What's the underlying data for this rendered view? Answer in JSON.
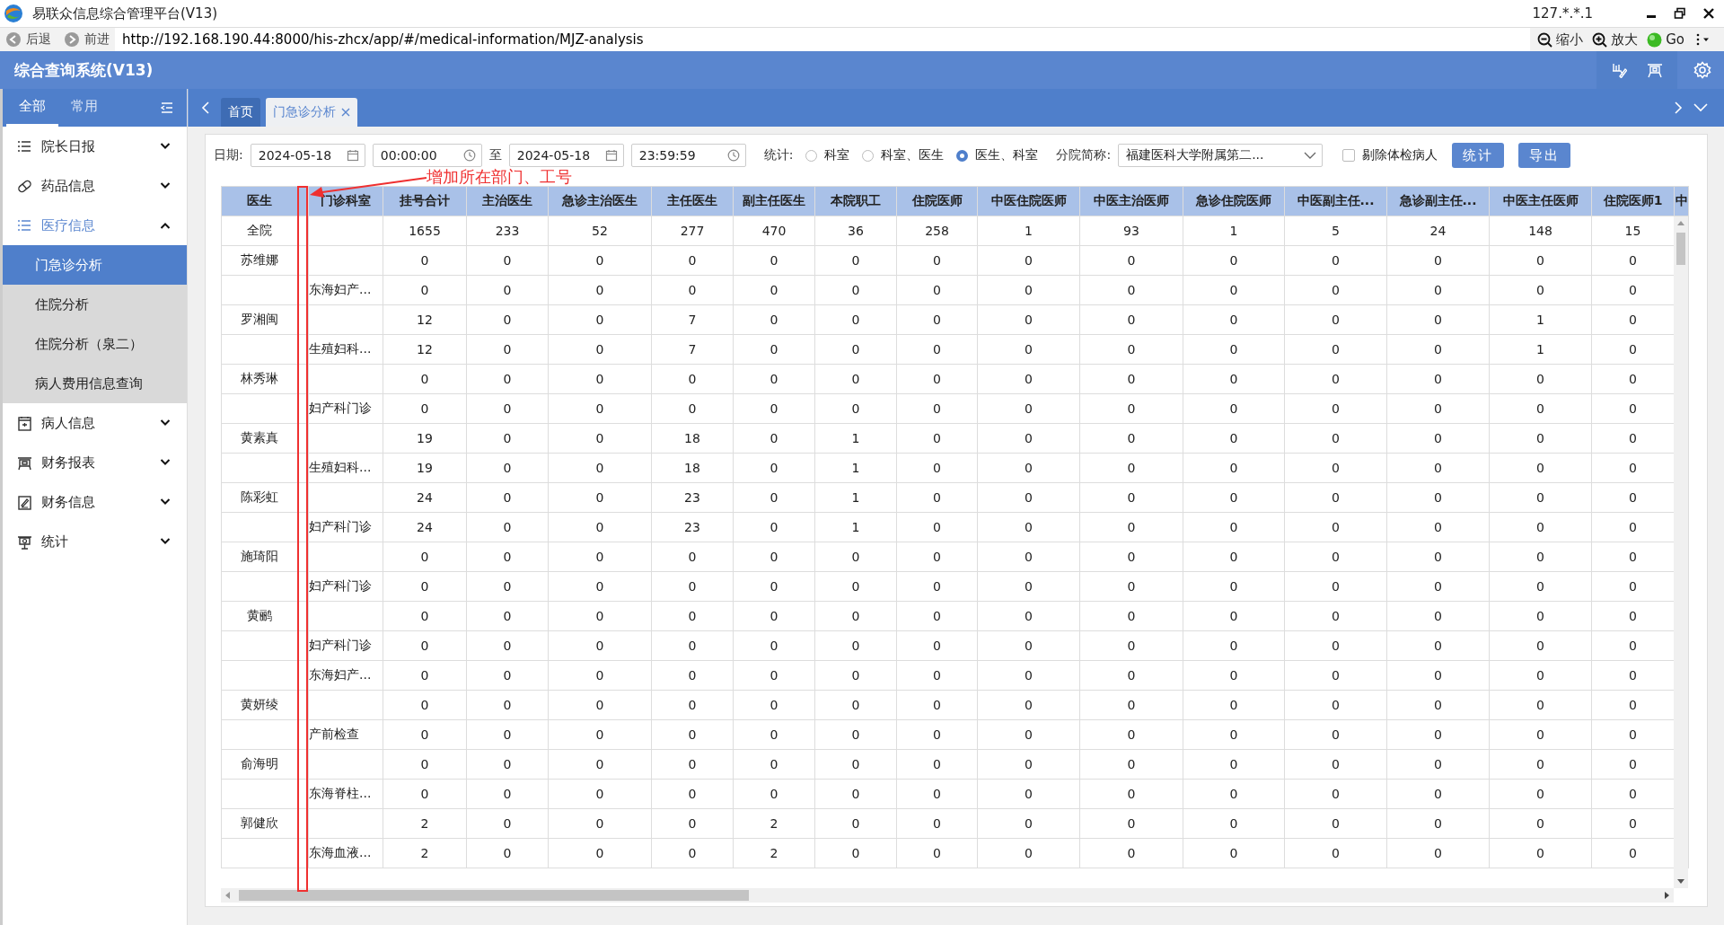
{
  "browser": {
    "title": "易联众信息综合管理平台(V13)",
    "host": "127.*.*.1",
    "nav": [
      {
        "label": "后退",
        "kind": "back"
      },
      {
        "label": "前进",
        "kind": "forward"
      }
    ],
    "url": "http://192.168.190.44:8000/his-zhcx/app/#/medical-information/MJZ-analysis",
    "tools": [
      {
        "label": "缩小",
        "kind": "zoom-out"
      },
      {
        "label": "放大",
        "kind": "zoom-in"
      },
      {
        "label": "Go",
        "kind": "go"
      }
    ]
  },
  "app": {
    "title": "综合查询系统(V13)"
  },
  "sidebar": {
    "tabs": [
      {
        "label": "全部",
        "selected": true
      },
      {
        "label": "常用",
        "selected": false
      }
    ],
    "items": [
      {
        "label": "院长日报",
        "kind": "list",
        "expanded": false
      },
      {
        "label": "药品信息",
        "kind": "pill",
        "expanded": false
      },
      {
        "label": "医疗信息",
        "kind": "list",
        "expanded": true,
        "children": [
          {
            "label": "门急诊分析",
            "selected": true
          },
          {
            "label": "住院分析",
            "selected": false
          },
          {
            "label": "住院分析（泉二）",
            "selected": false
          },
          {
            "label": "病人费用信息查询",
            "selected": false
          }
        ]
      },
      {
        "label": "病人信息",
        "kind": "calendar",
        "expanded": false
      },
      {
        "label": "财务报表",
        "kind": "board",
        "expanded": false
      },
      {
        "label": "财务信息",
        "kind": "edit",
        "expanded": false
      },
      {
        "label": "统计",
        "kind": "easel",
        "expanded": false
      }
    ]
  },
  "tabs": [
    {
      "label": "首页",
      "selected": false,
      "closable": false
    },
    {
      "label": "门急诊分析",
      "selected": true,
      "closable": true
    }
  ],
  "filter": {
    "date_label": "日期:",
    "start_date": "2024-05-18",
    "start_time": "00:00:00",
    "to_label": "至",
    "end_date": "2024-05-18",
    "end_time": "23:59:59",
    "stat_label": "统计:",
    "stat_options": [
      {
        "label": "科室",
        "selected": false
      },
      {
        "label": "科室、医生",
        "selected": false
      },
      {
        "label": "医生、科室",
        "selected": true
      }
    ],
    "branch_label": "分院简称:",
    "branch": "福建医科大学附属第二...",
    "exclude": {
      "label": "剔除体检病人",
      "checked": false
    },
    "buttons": [
      "统计",
      "导出"
    ]
  },
  "table": {
    "columns": [
      "医生",
      "门诊科室",
      "挂号合计",
      "主治医生",
      "急诊主治医生",
      "主任医生",
      "副主任医生",
      "本院职工",
      "住院医师",
      "中医住院医师",
      "中医主治医师",
      "急诊住院医师",
      "中医副主任...",
      "急诊副主任...",
      "中医主任医师",
      "住院医师1",
      "中"
    ],
    "rows": [
      {
        "doctor": "全院",
        "values": [
          "1655",
          "233",
          "52",
          "277",
          "470",
          "36",
          "258",
          "1",
          "93",
          "1",
          "5",
          "24",
          "148",
          "15"
        ]
      },
      {
        "doctor": "苏维娜",
        "values": [
          "0",
          "0",
          "0",
          "0",
          "0",
          "0",
          "0",
          "0",
          "0",
          "0",
          "0",
          "0",
          "0",
          "0"
        ]
      },
      {
        "dept": "东海妇产...",
        "values": [
          "0",
          "0",
          "0",
          "0",
          "0",
          "0",
          "0",
          "0",
          "0",
          "0",
          "0",
          "0",
          "0",
          "0"
        ]
      },
      {
        "doctor": "罗湘闽",
        "values": [
          "12",
          "0",
          "0",
          "7",
          "0",
          "0",
          "0",
          "0",
          "0",
          "0",
          "0",
          "0",
          "1",
          "0"
        ]
      },
      {
        "dept": "生殖妇科...",
        "values": [
          "12",
          "0",
          "0",
          "7",
          "0",
          "0",
          "0",
          "0",
          "0",
          "0",
          "0",
          "0",
          "1",
          "0"
        ]
      },
      {
        "doctor": "林秀琳",
        "values": [
          "0",
          "0",
          "0",
          "0",
          "0",
          "0",
          "0",
          "0",
          "0",
          "0",
          "0",
          "0",
          "0",
          "0"
        ]
      },
      {
        "dept": "妇产科门诊",
        "values": [
          "0",
          "0",
          "0",
          "0",
          "0",
          "0",
          "0",
          "0",
          "0",
          "0",
          "0",
          "0",
          "0",
          "0"
        ]
      },
      {
        "doctor": "黄素真",
        "values": [
          "19",
          "0",
          "0",
          "18",
          "0",
          "1",
          "0",
          "0",
          "0",
          "0",
          "0",
          "0",
          "0",
          "0"
        ]
      },
      {
        "dept": "生殖妇科...",
        "values": [
          "19",
          "0",
          "0",
          "18",
          "0",
          "1",
          "0",
          "0",
          "0",
          "0",
          "0",
          "0",
          "0",
          "0"
        ]
      },
      {
        "doctor": "陈彩虹",
        "values": [
          "24",
          "0",
          "0",
          "23",
          "0",
          "1",
          "0",
          "0",
          "0",
          "0",
          "0",
          "0",
          "0",
          "0"
        ]
      },
      {
        "dept": "妇产科门诊",
        "values": [
          "24",
          "0",
          "0",
          "23",
          "0",
          "1",
          "0",
          "0",
          "0",
          "0",
          "0",
          "0",
          "0",
          "0"
        ]
      },
      {
        "doctor": "施琦阳",
        "values": [
          "0",
          "0",
          "0",
          "0",
          "0",
          "0",
          "0",
          "0",
          "0",
          "0",
          "0",
          "0",
          "0",
          "0"
        ]
      },
      {
        "dept": "妇产科门诊",
        "values": [
          "0",
          "0",
          "0",
          "0",
          "0",
          "0",
          "0",
          "0",
          "0",
          "0",
          "0",
          "0",
          "0",
          "0"
        ]
      },
      {
        "doctor": "黄鹂",
        "values": [
          "0",
          "0",
          "0",
          "0",
          "0",
          "0",
          "0",
          "0",
          "0",
          "0",
          "0",
          "0",
          "0",
          "0"
        ]
      },
      {
        "dept": "妇产科门诊",
        "values": [
          "0",
          "0",
          "0",
          "0",
          "0",
          "0",
          "0",
          "0",
          "0",
          "0",
          "0",
          "0",
          "0",
          "0"
        ]
      },
      {
        "dept": "东海妇产...",
        "values": [
          "0",
          "0",
          "0",
          "0",
          "0",
          "0",
          "0",
          "0",
          "0",
          "0",
          "0",
          "0",
          "0",
          "0"
        ]
      },
      {
        "doctor": "黄妍绫",
        "values": [
          "0",
          "0",
          "0",
          "0",
          "0",
          "0",
          "0",
          "0",
          "0",
          "0",
          "0",
          "0",
          "0",
          "0"
        ]
      },
      {
        "dept": "产前检查",
        "values": [
          "0",
          "0",
          "0",
          "0",
          "0",
          "0",
          "0",
          "0",
          "0",
          "0",
          "0",
          "0",
          "0",
          "0"
        ]
      },
      {
        "doctor": "俞海明",
        "values": [
          "0",
          "0",
          "0",
          "0",
          "0",
          "0",
          "0",
          "0",
          "0",
          "0",
          "0",
          "0",
          "0",
          "0"
        ]
      },
      {
        "dept": "东海脊柱...",
        "values": [
          "0",
          "0",
          "0",
          "0",
          "0",
          "0",
          "0",
          "0",
          "0",
          "0",
          "0",
          "0",
          "0",
          "0"
        ]
      },
      {
        "doctor": "郭健欣",
        "values": [
          "2",
          "0",
          "0",
          "0",
          "2",
          "0",
          "0",
          "0",
          "0",
          "0",
          "0",
          "0",
          "0",
          "0"
        ]
      },
      {
        "dept": "东海血液...",
        "values": [
          "2",
          "0",
          "0",
          "0",
          "2",
          "0",
          "0",
          "0",
          "0",
          "0",
          "0",
          "0",
          "0",
          "0"
        ]
      }
    ]
  },
  "annotation": {
    "text": "增加所在部门、工号"
  }
}
